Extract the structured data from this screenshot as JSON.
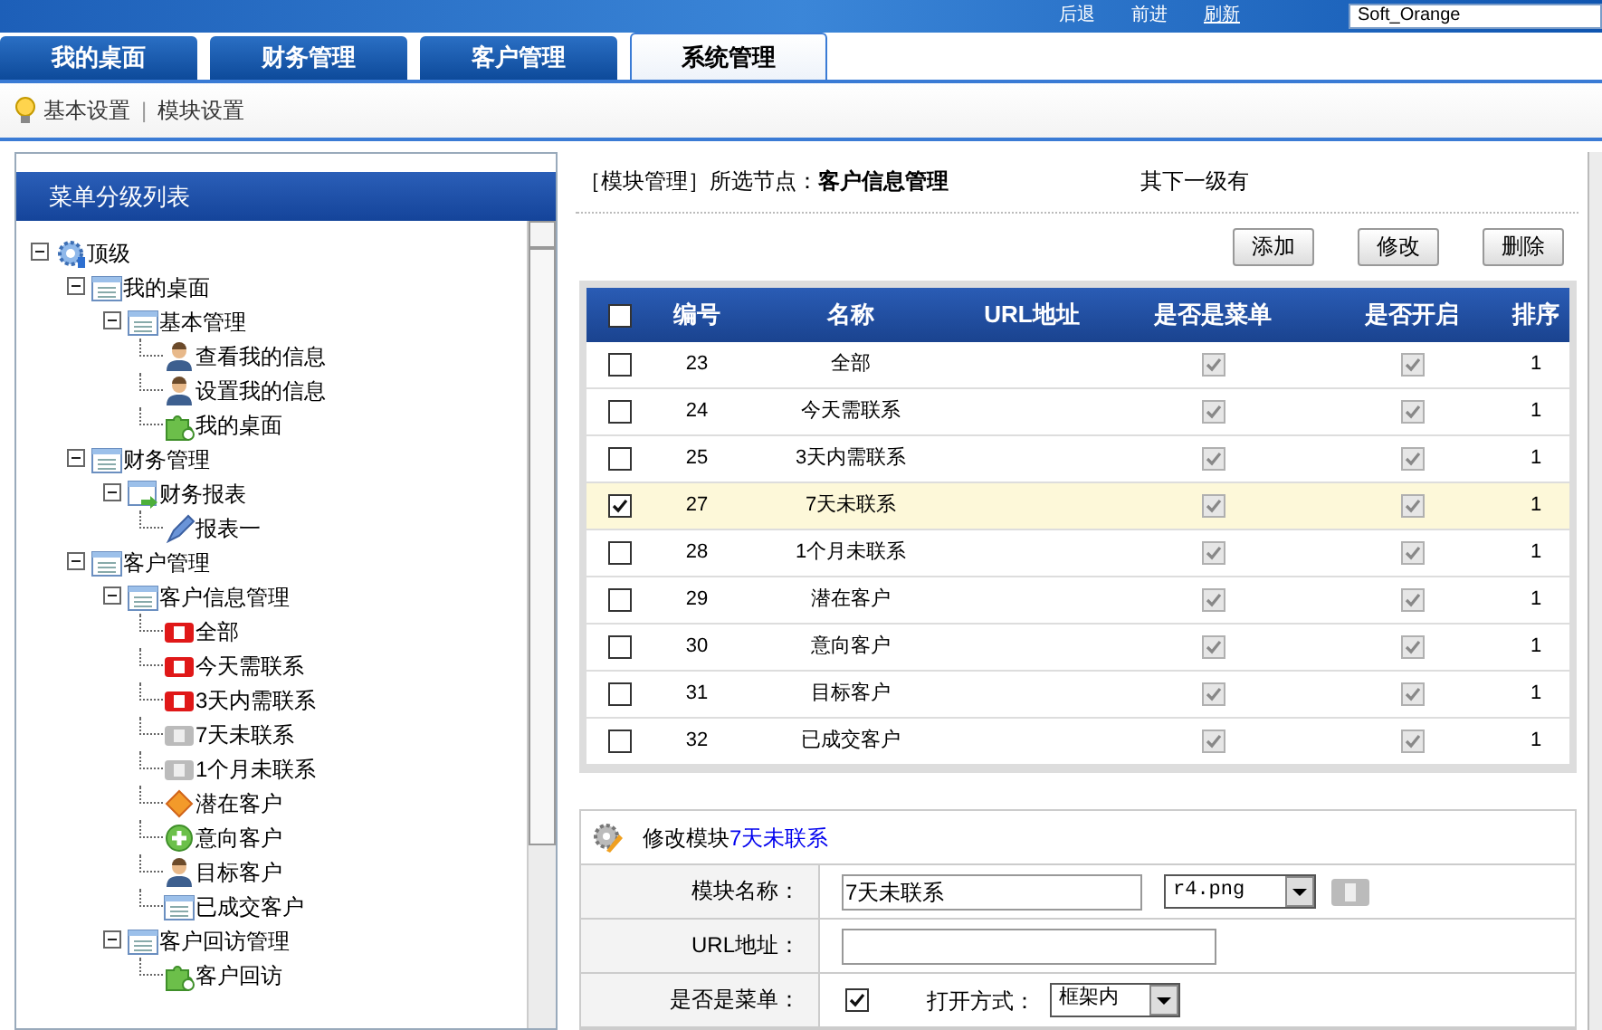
{
  "header": {
    "nav": [
      "后退",
      "前进",
      "刷新"
    ],
    "theme_select": "Soft_Orange"
  },
  "tabs": [
    {
      "label": "我的桌面",
      "selected": false
    },
    {
      "label": "财务管理",
      "selected": false
    },
    {
      "label": "客户管理",
      "selected": false
    },
    {
      "label": "系统管理",
      "selected": true
    }
  ],
  "breadcrumb": [
    "基本设置",
    "模块设置"
  ],
  "breadcrumb_separator": "|",
  "sidebar": {
    "title": "菜单分级列表",
    "tree": [
      {
        "label": "顶级",
        "kind": "gear",
        "expanded": true,
        "children": [
          {
            "label": "我的桌面",
            "kind": "list",
            "expanded": true,
            "children": [
              {
                "label": "基本管理",
                "kind": "list",
                "expanded": true,
                "children": [
                  {
                    "label": "查看我的信息",
                    "kind": "user"
                  },
                  {
                    "label": "设置我的信息",
                    "kind": "user"
                  },
                  {
                    "label": "我的桌面",
                    "kind": "puzzle"
                  }
                ]
              }
            ]
          },
          {
            "label": "财务管理",
            "kind": "list",
            "expanded": true,
            "children": [
              {
                "label": "财务报表",
                "kind": "report",
                "expanded": true,
                "children": [
                  {
                    "label": "报表一",
                    "kind": "pen"
                  }
                ]
              }
            ]
          },
          {
            "label": "客户管理",
            "kind": "list",
            "expanded": true,
            "children": [
              {
                "label": "客户信息管理",
                "kind": "list",
                "expanded": true,
                "children": [
                  {
                    "label": "全部",
                    "kind": "badge-red"
                  },
                  {
                    "label": "今天需联系",
                    "kind": "badge-red"
                  },
                  {
                    "label": "3天内需联系",
                    "kind": "badge-red"
                  },
                  {
                    "label": "7天未联系",
                    "kind": "badge-gray"
                  },
                  {
                    "label": "1个月未联系",
                    "kind": "badge-gray"
                  },
                  {
                    "label": "潜在客户",
                    "kind": "diamond"
                  },
                  {
                    "label": "意向客户",
                    "kind": "plus-circle"
                  },
                  {
                    "label": "目标客户",
                    "kind": "user"
                  },
                  {
                    "label": "已成交客户",
                    "kind": "list"
                  }
                ]
              },
              {
                "label": "客户回访管理",
                "kind": "list",
                "expanded": true,
                "children": [
                  {
                    "label": "客户回访",
                    "kind": "puzzle"
                  }
                ]
              }
            ]
          }
        ]
      }
    ]
  },
  "module": {
    "prefix": "［模块管理］所选节点：",
    "node": "客户信息管理",
    "subtitle": "其下一级有"
  },
  "actions": [
    "添加",
    "修改",
    "删除"
  ],
  "table": {
    "columns": [
      "编号",
      "名称",
      "URL地址",
      "是否是菜单",
      "是否开启",
      "排序"
    ],
    "all_checked": false,
    "rows": [
      {
        "id": "23",
        "name": "全部",
        "url": "",
        "is_menu": true,
        "enabled": true,
        "order": "1",
        "selected": false
      },
      {
        "id": "24",
        "name": "今天需联系",
        "url": "",
        "is_menu": true,
        "enabled": true,
        "order": "1",
        "selected": false
      },
      {
        "id": "25",
        "name": "3天内需联系",
        "url": "",
        "is_menu": true,
        "enabled": true,
        "order": "1",
        "selected": false
      },
      {
        "id": "27",
        "name": "7天未联系",
        "url": "",
        "is_menu": true,
        "enabled": true,
        "order": "1",
        "selected": true
      },
      {
        "id": "28",
        "name": "1个月未联系",
        "url": "",
        "is_menu": true,
        "enabled": true,
        "order": "1",
        "selected": false
      },
      {
        "id": "29",
        "name": "潜在客户",
        "url": "",
        "is_menu": true,
        "enabled": true,
        "order": "1",
        "selected": false
      },
      {
        "id": "30",
        "name": "意向客户",
        "url": "",
        "is_menu": true,
        "enabled": true,
        "order": "1",
        "selected": false
      },
      {
        "id": "31",
        "name": "目标客户",
        "url": "",
        "is_menu": true,
        "enabled": true,
        "order": "1",
        "selected": false
      },
      {
        "id": "32",
        "name": "已成交客户",
        "url": "",
        "is_menu": true,
        "enabled": true,
        "order": "1",
        "selected": false
      }
    ]
  },
  "form": {
    "title": "修改模块",
    "title_node": "7天未联系",
    "name_label": "模块名称：",
    "name_value": "7天未联系",
    "icon_select": "r4.png",
    "url_label": "URL地址：",
    "menu_label": "是否是菜单：",
    "is_menu": true,
    "open_label": "打开方式：",
    "open_select": "框架内"
  }
}
